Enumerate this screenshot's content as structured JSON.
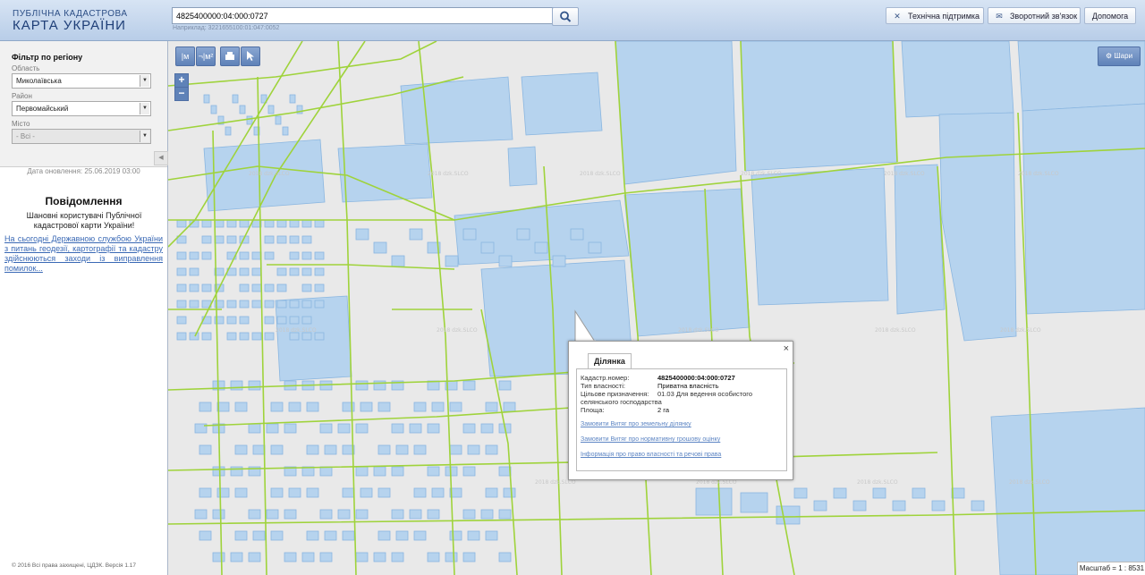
{
  "header": {
    "logo_small": "ПУБЛІЧНА КАДАСТРОВА",
    "logo_big": "КАРТА УКРАЇНИ",
    "search_value": "4825400000:04:000:0727",
    "search_hint": "Наприклад: 3221655100:01:047:0052",
    "buttons": {
      "support": "Технічна підтримка",
      "feedback": "Зворотний зв'язок",
      "help": "Допомога"
    }
  },
  "sidebar": {
    "filter_title": "Фільтр по регіону",
    "region_label": "Область",
    "region_value": "Миколаївська",
    "district_label": "Район",
    "district_value": "Первомайський",
    "city_label": "Місто",
    "city_value": "- Всі -",
    "update_date": "Дата оновлення: 25.06.2019 03:00",
    "message_title": "Повідомлення",
    "message_text": "Шановні користувачі Публічної кадастрової карти України!",
    "message_link": "На сьогодні Державною службою України з питань геодезії, картографії та кадастру здійснюються заходи із виправлення помилок...",
    "copyright": "© 2016 Всі права захищені, ЦДЗК. Версія 1.17"
  },
  "map": {
    "layers_label": "Шари",
    "scale_text": "Масштаб = 1 : 8531",
    "tools": {
      "measure": "|м",
      "measure_area": "¬|м²"
    },
    "watermark": "2018 dzk.SLCO"
  },
  "popup": {
    "tab": "Ділянка",
    "rows": [
      {
        "label": "Кадастр.номер:",
        "value": "4825400000:04:000:0727"
      },
      {
        "label": "Тип власності:",
        "value": "Приватна власність"
      },
      {
        "label": "Цільове призначення:",
        "value": "01.03 Для ведення особистого селянського господарства"
      },
      {
        "label": "Площа:",
        "value": "2 га"
      }
    ],
    "links": [
      "Замовити Витяг про земельну ділянку",
      "Замовити Витяг про нормативну грошову оцінку",
      "Інформація про право власності та речові права"
    ]
  }
}
